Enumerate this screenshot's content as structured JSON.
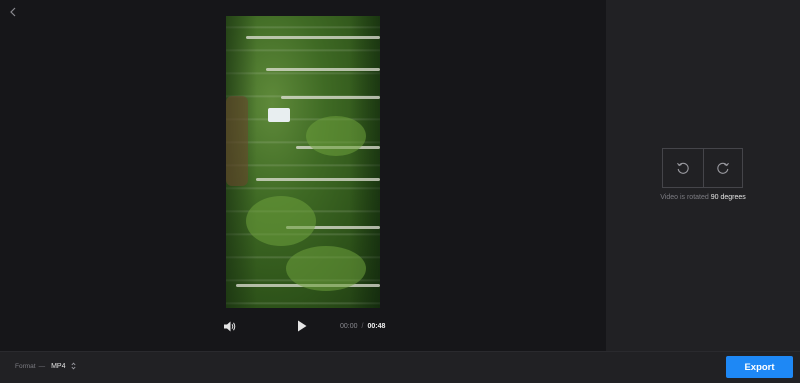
{
  "player": {
    "current_time": "00:00",
    "separator": "/",
    "duration": "00:48"
  },
  "rotation": {
    "info_prefix": "Video is rotated",
    "info_degrees": "90 degrees"
  },
  "format": {
    "label": "Format",
    "dash": "—",
    "value": "MP4"
  },
  "export": {
    "label": "Export"
  },
  "colors": {
    "accent": "#1e88f5",
    "background": "#161619",
    "panel": "#212124"
  },
  "icons": {
    "back": "chevron-left-icon",
    "volume": "volume-icon",
    "play": "play-icon",
    "rotate_left": "rotate-ccw-icon",
    "rotate_right": "rotate-cw-icon",
    "select": "select-arrows-icon"
  }
}
